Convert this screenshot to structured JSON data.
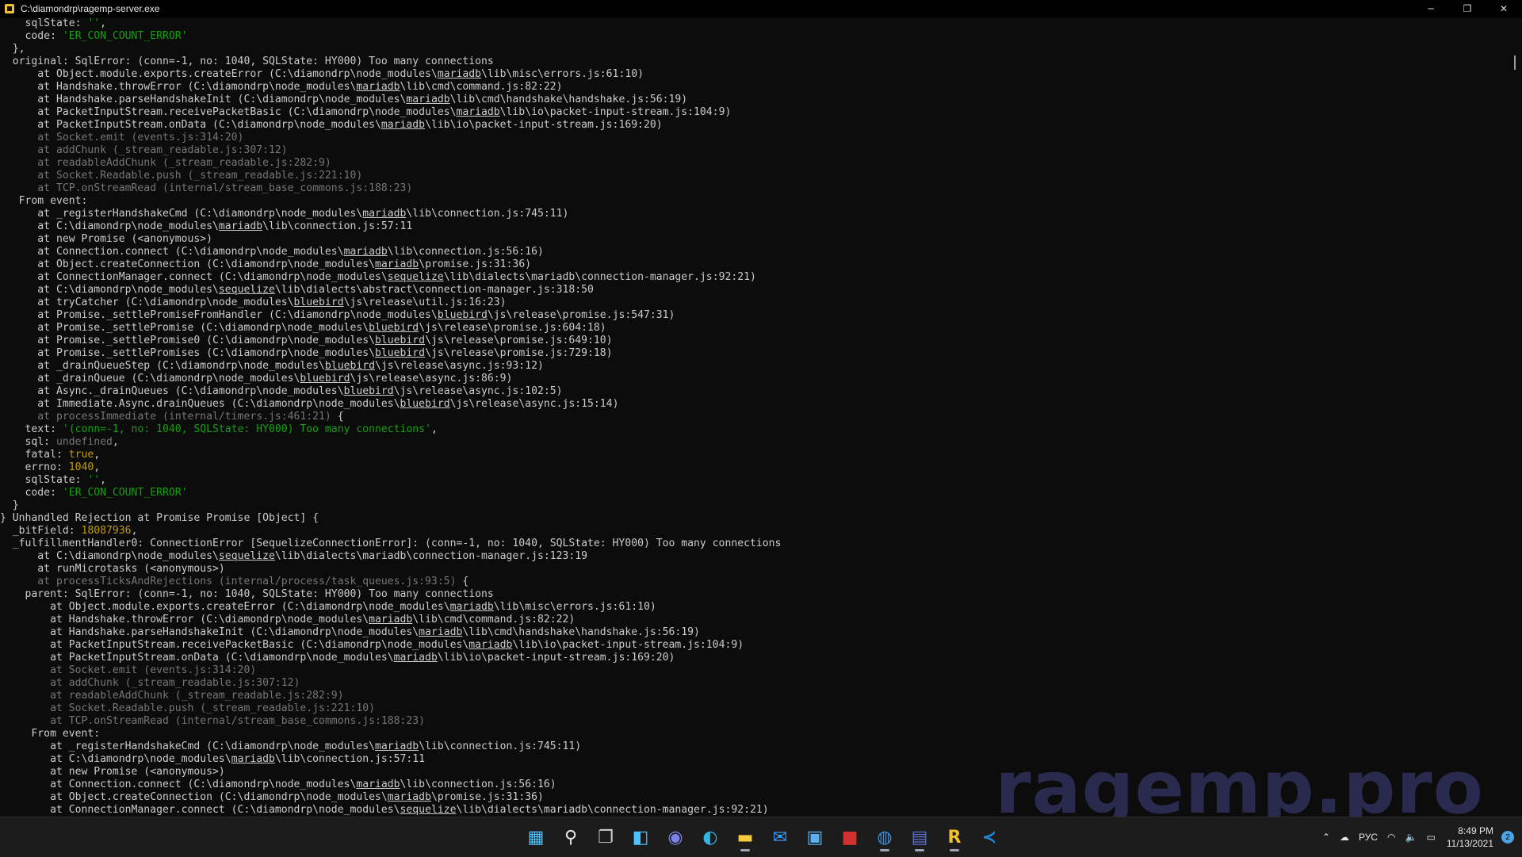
{
  "window": {
    "title": "C:\\diamondrp\\ragemp-server.exe",
    "minimize_glyph": "─",
    "maximize_glyph": "❐",
    "close_glyph": "✕"
  },
  "console_lines": [
    [
      {
        "t": "    sqlState: "
      },
      {
        "t": "''",
        "c": "str"
      },
      {
        "t": ","
      }
    ],
    [
      {
        "t": "    code: "
      },
      {
        "t": "'ER_CON_COUNT_ERROR'",
        "c": "str"
      }
    ],
    [
      {
        "t": "  },"
      }
    ],
    [
      {
        "t": "  original: SqlError: (conn=-1, no: 1040, SQLState: HY000) Too many connections"
      }
    ],
    [
      {
        "t": "      at Object.module.exports.createError (C:\\diamondrp\\node_modules\\"
      },
      {
        "t": "mariadb",
        "c": "und"
      },
      {
        "t": "\\lib\\misc\\errors.js:61:10)"
      }
    ],
    [
      {
        "t": "      at Handshake.throwError (C:\\diamondrp\\node_modules\\"
      },
      {
        "t": "mariadb",
        "c": "und"
      },
      {
        "t": "\\lib\\cmd\\command.js:82:22)"
      }
    ],
    [
      {
        "t": "      at Handshake.parseHandshakeInit (C:\\diamondrp\\node_modules\\"
      },
      {
        "t": "mariadb",
        "c": "und"
      },
      {
        "t": "\\lib\\cmd\\handshake\\handshake.js:56:19)"
      }
    ],
    [
      {
        "t": "      at PacketInputStream.receivePacketBasic (C:\\diamondrp\\node_modules\\"
      },
      {
        "t": "mariadb",
        "c": "und"
      },
      {
        "t": "\\lib\\io\\packet-input-stream.js:104:9)"
      }
    ],
    [
      {
        "t": "      at PacketInputStream.onData (C:\\diamondrp\\node_modules\\"
      },
      {
        "t": "mariadb",
        "c": "und"
      },
      {
        "t": "\\lib\\io\\packet-input-stream.js:169:20)"
      }
    ],
    [
      {
        "t": "      at Socket.emit (events.js:314:20)",
        "c": "gray"
      }
    ],
    [
      {
        "t": "      at addChunk (_stream_readable.js:307:12)",
        "c": "gray"
      }
    ],
    [
      {
        "t": "      at readableAddChunk (_stream_readable.js:282:9)",
        "c": "gray"
      }
    ],
    [
      {
        "t": "      at Socket.Readable.push (_stream_readable.js:221:10)",
        "c": "gray"
      }
    ],
    [
      {
        "t": "      at TCP.onStreamRead (internal/stream_base_commons.js:188:23)",
        "c": "gray"
      }
    ],
    [
      {
        "t": "   From event:"
      }
    ],
    [
      {
        "t": "      at _registerHandshakeCmd (C:\\diamondrp\\node_modules\\"
      },
      {
        "t": "mariadb",
        "c": "und"
      },
      {
        "t": "\\lib\\connection.js:745:11)"
      }
    ],
    [
      {
        "t": "      at C:\\diamondrp\\node_modules\\"
      },
      {
        "t": "mariadb",
        "c": "und"
      },
      {
        "t": "\\lib\\connection.js:57:11"
      }
    ],
    [
      {
        "t": "      at new Promise (<anonymous>)"
      }
    ],
    [
      {
        "t": "      at Connection.connect (C:\\diamondrp\\node_modules\\"
      },
      {
        "t": "mariadb",
        "c": "und"
      },
      {
        "t": "\\lib\\connection.js:56:16)"
      }
    ],
    [
      {
        "t": "      at Object.createConnection (C:\\diamondrp\\node_modules\\"
      },
      {
        "t": "mariadb",
        "c": "und"
      },
      {
        "t": "\\promise.js:31:36)"
      }
    ],
    [
      {
        "t": "      at ConnectionManager.connect (C:\\diamondrp\\node_modules\\"
      },
      {
        "t": "sequelize",
        "c": "und"
      },
      {
        "t": "\\lib\\dialects\\mariadb\\connection-manager.js:92:21)"
      }
    ],
    [
      {
        "t": "      at C:\\diamondrp\\node_modules\\"
      },
      {
        "t": "sequelize",
        "c": "und"
      },
      {
        "t": "\\lib\\dialects\\abstract\\connection-manager.js:318:50"
      }
    ],
    [
      {
        "t": "      at tryCatcher (C:\\diamondrp\\node_modules\\"
      },
      {
        "t": "bluebird",
        "c": "und"
      },
      {
        "t": "\\js\\release\\util.js:16:23)"
      }
    ],
    [
      {
        "t": "      at Promise._settlePromiseFromHandler (C:\\diamondrp\\node_modules\\"
      },
      {
        "t": "bluebird",
        "c": "und"
      },
      {
        "t": "\\js\\release\\promise.js:547:31)"
      }
    ],
    [
      {
        "t": "      at Promise._settlePromise (C:\\diamondrp\\node_modules\\"
      },
      {
        "t": "bluebird",
        "c": "und"
      },
      {
        "t": "\\js\\release\\promise.js:604:18)"
      }
    ],
    [
      {
        "t": "      at Promise._settlePromise0 (C:\\diamondrp\\node_modules\\"
      },
      {
        "t": "bluebird",
        "c": "und"
      },
      {
        "t": "\\js\\release\\promise.js:649:10)"
      }
    ],
    [
      {
        "t": "      at Promise._settlePromises (C:\\diamondrp\\node_modules\\"
      },
      {
        "t": "bluebird",
        "c": "und"
      },
      {
        "t": "\\js\\release\\promise.js:729:18)"
      }
    ],
    [
      {
        "t": "      at _drainQueueStep (C:\\diamondrp\\node_modules\\"
      },
      {
        "t": "bluebird",
        "c": "und"
      },
      {
        "t": "\\js\\release\\async.js:93:12)"
      }
    ],
    [
      {
        "t": "      at _drainQueue (C:\\diamondrp\\node_modules\\"
      },
      {
        "t": "bluebird",
        "c": "und"
      },
      {
        "t": "\\js\\release\\async.js:86:9)"
      }
    ],
    [
      {
        "t": "      at Async._drainQueues (C:\\diamondrp\\node_modules\\"
      },
      {
        "t": "bluebird",
        "c": "und"
      },
      {
        "t": "\\js\\release\\async.js:102:5)"
      }
    ],
    [
      {
        "t": "      at Immediate.Async.drainQueues (C:\\diamondrp\\node_modules\\"
      },
      {
        "t": "bluebird",
        "c": "und"
      },
      {
        "t": "\\js\\release\\async.js:15:14)"
      }
    ],
    [
      {
        "t": "      at processImmediate (internal/timers.js:461:21)",
        "c": "gray"
      },
      {
        "t": " {"
      }
    ],
    [
      {
        "t": "    text: "
      },
      {
        "t": "'(conn=-1, no: 1040, SQLState: HY000) Too many connections'",
        "c": "str"
      },
      {
        "t": ","
      }
    ],
    [
      {
        "t": "    sql: "
      },
      {
        "t": "undefined",
        "c": "gray"
      },
      {
        "t": ","
      }
    ],
    [
      {
        "t": "    fatal: "
      },
      {
        "t": "true",
        "c": "num"
      },
      {
        "t": ","
      }
    ],
    [
      {
        "t": "    errno: "
      },
      {
        "t": "1040",
        "c": "num"
      },
      {
        "t": ","
      }
    ],
    [
      {
        "t": "    sqlState: "
      },
      {
        "t": "''",
        "c": "str"
      },
      {
        "t": ","
      }
    ],
    [
      {
        "t": "    code: "
      },
      {
        "t": "'ER_CON_COUNT_ERROR'",
        "c": "str"
      }
    ],
    [
      {
        "t": "  }"
      }
    ],
    [
      {
        "t": "} Unhandled Rejection at Promise Promise [Object] {"
      }
    ],
    [
      {
        "t": "  _bitField: "
      },
      {
        "t": "18087936",
        "c": "num"
      },
      {
        "t": ","
      }
    ],
    [
      {
        "t": "  _fulfillmentHandler0: ConnectionError [SequelizeConnectionError]: (conn=-1, no: 1040, SQLState: HY000) Too many connections"
      }
    ],
    [
      {
        "t": "      at C:\\diamondrp\\node_modules\\"
      },
      {
        "t": "sequelize",
        "c": "und"
      },
      {
        "t": "\\lib\\dialects\\mariadb\\connection-manager.js:123:19"
      }
    ],
    [
      {
        "t": "      at runMicrotasks (<anonymous>)"
      }
    ],
    [
      {
        "t": "      at processTicksAndRejections (internal/process/task_queues.js:93:5)",
        "c": "gray"
      },
      {
        "t": " {"
      }
    ],
    [
      {
        "t": "    parent: SqlError: (conn=-1, no: 1040, SQLState: HY000) Too many connections"
      }
    ],
    [
      {
        "t": "        at Object.module.exports.createError (C:\\diamondrp\\node_modules\\"
      },
      {
        "t": "mariadb",
        "c": "und"
      },
      {
        "t": "\\lib\\misc\\errors.js:61:10)"
      }
    ],
    [
      {
        "t": "        at Handshake.throwError (C:\\diamondrp\\node_modules\\"
      },
      {
        "t": "mariadb",
        "c": "und"
      },
      {
        "t": "\\lib\\cmd\\command.js:82:22)"
      }
    ],
    [
      {
        "t": "        at Handshake.parseHandshakeInit (C:\\diamondrp\\node_modules\\"
      },
      {
        "t": "mariadb",
        "c": "und"
      },
      {
        "t": "\\lib\\cmd\\handshake\\handshake.js:56:19)"
      }
    ],
    [
      {
        "t": "        at PacketInputStream.receivePacketBasic (C:\\diamondrp\\node_modules\\"
      },
      {
        "t": "mariadb",
        "c": "und"
      },
      {
        "t": "\\lib\\io\\packet-input-stream.js:104:9)"
      }
    ],
    [
      {
        "t": "        at PacketInputStream.onData (C:\\diamondrp\\node_modules\\"
      },
      {
        "t": "mariadb",
        "c": "und"
      },
      {
        "t": "\\lib\\io\\packet-input-stream.js:169:20)"
      }
    ],
    [
      {
        "t": "        at Socket.emit (events.js:314:20)",
        "c": "gray"
      }
    ],
    [
      {
        "t": "        at addChunk (_stream_readable.js:307:12)",
        "c": "gray"
      }
    ],
    [
      {
        "t": "        at readableAddChunk (_stream_readable.js:282:9)",
        "c": "gray"
      }
    ],
    [
      {
        "t": "        at Socket.Readable.push (_stream_readable.js:221:10)",
        "c": "gray"
      }
    ],
    [
      {
        "t": "        at TCP.onStreamRead (internal/stream_base_commons.js:188:23)",
        "c": "gray"
      }
    ],
    [
      {
        "t": "     From event:"
      }
    ],
    [
      {
        "t": "        at _registerHandshakeCmd (C:\\diamondrp\\node_modules\\"
      },
      {
        "t": "mariadb",
        "c": "und"
      },
      {
        "t": "\\lib\\connection.js:745:11)"
      }
    ],
    [
      {
        "t": "        at C:\\diamondrp\\node_modules\\"
      },
      {
        "t": "mariadb",
        "c": "und"
      },
      {
        "t": "\\lib\\connection.js:57:11"
      }
    ],
    [
      {
        "t": "        at new Promise (<anonymous>)"
      }
    ],
    [
      {
        "t": "        at Connection.connect (C:\\diamondrp\\node_modules\\"
      },
      {
        "t": "mariadb",
        "c": "und"
      },
      {
        "t": "\\lib\\connection.js:56:16)"
      }
    ],
    [
      {
        "t": "        at Object.createConnection (C:\\diamondrp\\node_modules\\"
      },
      {
        "t": "mariadb",
        "c": "und"
      },
      {
        "t": "\\promise.js:31:36)"
      }
    ],
    [
      {
        "t": "        at ConnectionManager.connect (C:\\diamondrp\\node_modules\\"
      },
      {
        "t": "sequelize",
        "c": "und"
      },
      {
        "t": "\\lib\\dialects\\mariadb\\connection-manager.js:92:21)"
      }
    ]
  ],
  "watermark": "ragemp.pro",
  "taskbar": {
    "apps": [
      {
        "name": "start-icon",
        "color": "#4cc2ff",
        "glyph": "▦",
        "active": false
      },
      {
        "name": "search-icon",
        "color": "#e6e6e6",
        "glyph": "⚲",
        "active": false
      },
      {
        "name": "task-view-icon",
        "color": "#d0d0d0",
        "glyph": "❐",
        "active": false
      },
      {
        "name": "widgets-icon",
        "color": "#4cc2ff",
        "glyph": "◧",
        "active": false
      },
      {
        "name": "chat-icon",
        "color": "#7b83eb",
        "glyph": "◉",
        "active": false
      },
      {
        "name": "edge-icon",
        "color": "#2fb5e8",
        "glyph": "◐",
        "active": false
      },
      {
        "name": "file-explorer-icon",
        "color": "#f8c93a",
        "glyph": "▬",
        "active": true
      },
      {
        "name": "mail-icon",
        "color": "#3aa0ff",
        "glyph": "✉",
        "active": false
      },
      {
        "name": "store-icon",
        "color": "#5ab0f0",
        "glyph": "▣",
        "active": false
      },
      {
        "name": "app-red-icon",
        "color": "#d03030",
        "glyph": "■",
        "active": false
      },
      {
        "name": "firefox-icon",
        "color": "#3a8fe0",
        "glyph": "◍",
        "active": true
      },
      {
        "name": "app-icon",
        "color": "#5a70d0",
        "glyph": "▤",
        "active": true
      },
      {
        "name": "ragemp-icon",
        "color": "#f0c030",
        "glyph": "R",
        "active": true
      },
      {
        "name": "vscode-icon",
        "color": "#1e8ad8",
        "glyph": "≺",
        "active": false
      }
    ],
    "tray": {
      "chevron": "⌃",
      "cloud": "☁",
      "language": "РУС",
      "wifi": "◠",
      "volume": "🔈",
      "battery": "▭",
      "time": "8:49 PM",
      "date": "11/13/2021",
      "notifications": "2"
    }
  }
}
